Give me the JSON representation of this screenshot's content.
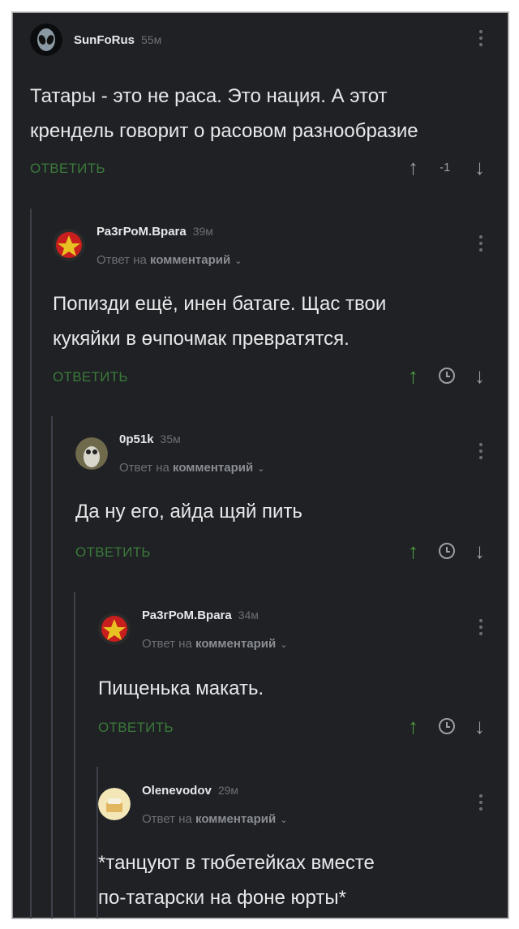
{
  "comments": [
    {
      "username": "SunFoRus",
      "time": "55м",
      "reply_meta": null,
      "text": "Татары - это не раса. Это нация. А этот\nкрендель говорит о расовом разнообразие",
      "reply_label": "ОТВЕТИТЬ",
      "score": "-1",
      "upvoted": false,
      "avatar_icon": "alien-avatar-icon"
    },
    {
      "username": "Ра3гРоМ.Враrа",
      "time": "39м",
      "reply_meta": {
        "prefix": "Ответ на",
        "link": "комментарий"
      },
      "text": "Попизди ещё, инен батаге. Щас твои\nкукяйки в өчпочмак превратятся.",
      "reply_label": "ОТВЕТИТЬ",
      "upvoted": true,
      "avatar_icon": "crest-avatar-icon"
    },
    {
      "username": "0p51k",
      "time": "35м",
      "reply_meta": {
        "prefix": "Ответ на",
        "link": "комментарий"
      },
      "text": "Да ну его, айда щяй пить",
      "reply_label": "ОТВЕТИТЬ",
      "upvoted": true,
      "avatar_icon": "owl-avatar-icon"
    },
    {
      "username": "Ра3гРоМ.Враrа",
      "time": "34м",
      "reply_meta": {
        "prefix": "Ответ на",
        "link": "комментарий"
      },
      "text": "Пищенька макать.",
      "reply_label": "ОТВЕТИТЬ",
      "upvoted": true,
      "avatar_icon": "crest-avatar-icon"
    },
    {
      "username": "Olenevodov",
      "time": "29м",
      "reply_meta": {
        "prefix": "Ответ на",
        "link": "комментарий"
      },
      "text": "*танцуют в тюбетейках вместе\nпо-татарски на фоне юрты*",
      "reply_label": null,
      "upvoted": false,
      "avatar_icon": "cake-avatar-icon"
    }
  ],
  "colors": {
    "background": "#1f2125",
    "reply_green": "#3b7a39",
    "upvote_green": "#4e9a3f",
    "muted": "#6c6f75"
  }
}
